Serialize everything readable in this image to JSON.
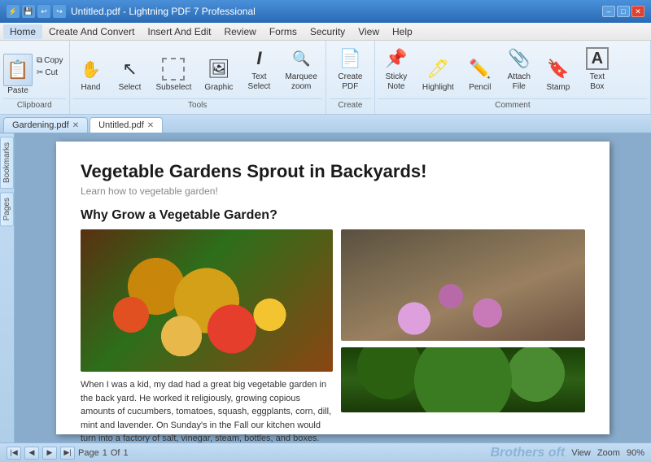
{
  "titlebar": {
    "title": "Untitled.pdf - Lightning PDF 7 Professional",
    "min": "–",
    "max": "□",
    "close": "✕"
  },
  "menubar": {
    "items": [
      "Home",
      "Create And Convert",
      "Insert And Edit",
      "Review",
      "Forms",
      "Security",
      "View",
      "Help"
    ]
  },
  "ribbon": {
    "groups": [
      {
        "label": "Clipboard",
        "buttons": [
          {
            "id": "paste",
            "label": "Paste",
            "icon": "📋",
            "large": true
          },
          {
            "id": "copy",
            "label": "Copy"
          },
          {
            "id": "cut",
            "label": "Cut"
          }
        ]
      },
      {
        "label": "Tools",
        "buttons": [
          {
            "id": "hand",
            "label": "Hand",
            "icon": "✋",
            "large": true
          },
          {
            "id": "select",
            "label": "Select",
            "icon": "↖",
            "large": true
          },
          {
            "id": "subselect",
            "label": "Subselect",
            "icon": "⬚",
            "large": true
          },
          {
            "id": "graphic",
            "label": "Graphic",
            "icon": "▦",
            "large": true
          },
          {
            "id": "textselect",
            "label": "Text\nSelect",
            "icon": "T",
            "large": true
          },
          {
            "id": "marquee",
            "label": "Marquee\nzoom",
            "icon": "⬜",
            "large": true
          }
        ]
      },
      {
        "label": "Create",
        "buttons": [
          {
            "id": "createpdf",
            "label": "Create\nPDF",
            "icon": "📄",
            "large": true
          }
        ]
      },
      {
        "label": "Comment",
        "buttons": [
          {
            "id": "sticky",
            "label": "Sticky\nNote",
            "icon": "📌",
            "large": true
          },
          {
            "id": "highlight",
            "label": "Highlight",
            "icon": "🖊",
            "large": true
          },
          {
            "id": "pencil",
            "label": "Pencil",
            "icon": "✏",
            "large": true
          },
          {
            "id": "attach",
            "label": "Attach\nFile",
            "icon": "📎",
            "large": true
          },
          {
            "id": "stamp",
            "label": "Stamp",
            "icon": "🔖",
            "large": true
          },
          {
            "id": "textbox",
            "label": "Text\nBox",
            "icon": "🗒",
            "large": true
          }
        ]
      }
    ]
  },
  "tabs": [
    {
      "label": "Gardening.pdf",
      "active": false
    },
    {
      "label": "Untitled.pdf",
      "active": true
    }
  ],
  "sidepanels": {
    "left": [
      "Bookmarks",
      "Pages"
    ]
  },
  "document": {
    "title": "Vegetable Gardens Sprout in Backyards!",
    "subtitle": "Learn how to vegetable garden!",
    "section1_title": "Why Grow a Vegetable Garden?",
    "body_text": "When I was a kid, my dad had a great big vegetable garden in the back yard. He worked it religiously, growing copious amounts of cucumbers, tomatoes, squash, eggplants, corn, dill, mint and lavender. On Sunday's in the Fall our kitchen would turn into a factory of salt, vinegar, steam, bottles, and boxes. Our basement cupboards were full of preserved food"
  },
  "statusbar": {
    "page_label": "Page",
    "page_num": "1",
    "of": "Of",
    "total": "1",
    "view_label": "View",
    "zoom_label": "Zoom",
    "zoom_value": "90%",
    "watermark": "Brothers oft"
  }
}
